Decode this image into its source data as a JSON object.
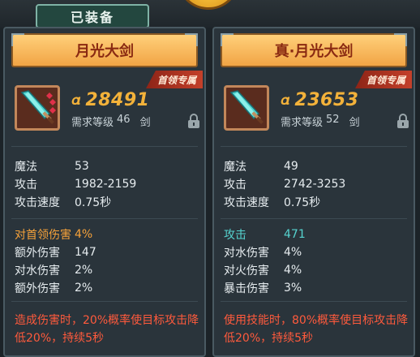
{
  "header": {
    "equipped_label": "已装备"
  },
  "cards": [
    {
      "title": "月光大剑",
      "badge": "首领专属",
      "power": "28491",
      "req_label": "需求等级",
      "req_level": "46",
      "weapon_type": "剑",
      "stats": [
        {
          "label": "魔法",
          "value": "53"
        },
        {
          "label": "攻击",
          "value": "1982-2159"
        },
        {
          "label": "攻击速度",
          "value": "0.75秒"
        }
      ],
      "bonuses": [
        {
          "label": "对首领伤害",
          "value": "4%"
        },
        {
          "label": "额外伤害",
          "value": "147"
        },
        {
          "label": "对水伤害",
          "value": "2%"
        },
        {
          "label": "额外伤害",
          "value": "2%"
        }
      ],
      "effect": "造成伤害时，20%概率使目标攻击降低20%，持续5秒"
    },
    {
      "title": "真·月光大剑",
      "badge": "首领专属",
      "power": "23653",
      "req_label": "需求等级",
      "req_level": "52",
      "weapon_type": "剑",
      "stats": [
        {
          "label": "魔法",
          "value": "49"
        },
        {
          "label": "攻击",
          "value": "2742-3253"
        },
        {
          "label": "攻击速度",
          "value": "0.75秒"
        }
      ],
      "bonuses": [
        {
          "label": "攻击",
          "value": "471"
        },
        {
          "label": "对水伤害",
          "value": "4%"
        },
        {
          "label": "对火伤害",
          "value": "4%"
        },
        {
          "label": "暴击伤害",
          "value": "3%"
        }
      ],
      "effect": "使用技能时，80%概率使目标攻击降低20%，持续5秒"
    }
  ],
  "colors": {
    "title_text": "#8a2a12",
    "power": "#f3b23a",
    "highlight_orange": "#f6a23a",
    "highlight_cyan": "#56d4d0",
    "effect_red": "#ff5a3c"
  },
  "icons": {
    "power": "power-icon",
    "lock": "lock-icon",
    "weapon": "sword-icon"
  }
}
